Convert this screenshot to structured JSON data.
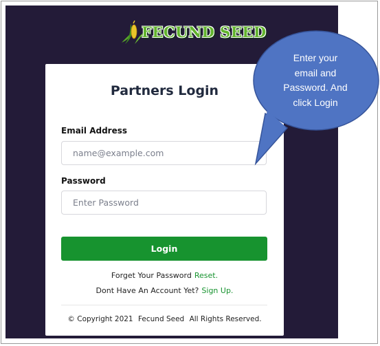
{
  "logo": {
    "text": "FECUND SEED"
  },
  "login": {
    "title": "Partners Login",
    "email_label": "Email Address",
    "email_placeholder": "name@example.com",
    "password_label": "Password",
    "password_placeholder": "Enter Password",
    "login_button": "Login",
    "forgot_text": "Forget Your Password",
    "reset_link": "Reset.",
    "no_account_text": "Dont Have An Account Yet?",
    "signup_link": "Sign Up."
  },
  "footer": {
    "copyright": "© Copyright 2021",
    "brand": "Fecund Seed",
    "rights": "All Rights Reserved."
  },
  "callout": {
    "lines": [
      "Enter your",
      "email and",
      "Password. And",
      "click Login"
    ]
  },
  "colors": {
    "background": "#231b38",
    "accent_green": "#17932f",
    "callout_fill": "#4f74c3"
  }
}
